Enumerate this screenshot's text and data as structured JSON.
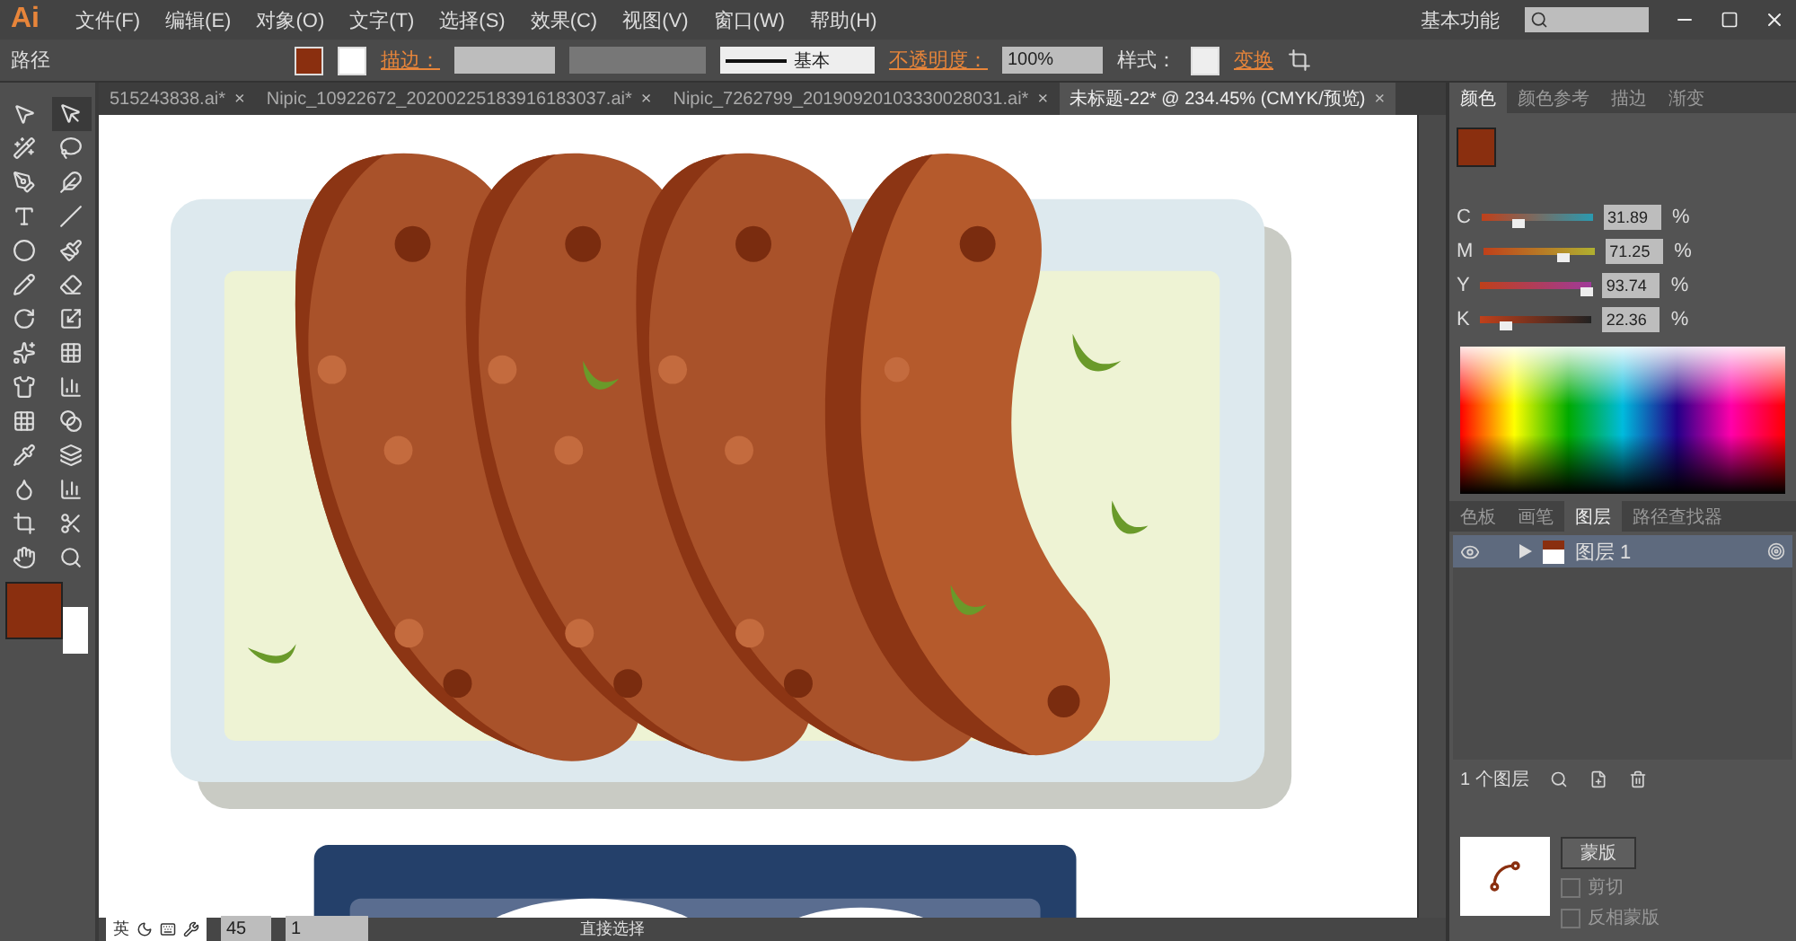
{
  "app_logo": "Ai",
  "menu": [
    "文件(F)",
    "编辑(E)",
    "对象(O)",
    "文字(T)",
    "选择(S)",
    "效果(C)",
    "视图(V)",
    "窗口(W)",
    "帮助(H)"
  ],
  "workspace": "基本功能",
  "control_bar": {
    "object_type": "路径",
    "stroke_label": "描边：",
    "stroke_profile": "基本",
    "opacity_label": "不透明度：",
    "opacity": "100%",
    "style_label": "样式：",
    "transform_label": "变换"
  },
  "doc_tabs": [
    {
      "label": "515243838.ai*",
      "close": "×",
      "selected": false
    },
    {
      "label": "Nipic_10922672_20200225183916183037.ai*",
      "close": "×",
      "selected": false
    },
    {
      "label": "Nipic_7262799_20190920103330028031.ai*",
      "close": "×",
      "selected": false
    },
    {
      "label": "未标题-22* @ 234.45% (CMYK/预览)",
      "close": "×",
      "selected": true
    }
  ],
  "color_panel": {
    "tabs": [
      {
        "label": "颜色",
        "selected": true
      },
      {
        "label": "颜色参考",
        "selected": false
      },
      {
        "label": "描边",
        "selected": false
      },
      {
        "label": "渐变",
        "selected": false
      }
    ],
    "channels": [
      {
        "name": "C",
        "level": 0.32,
        "value": "31.89"
      },
      {
        "name": "M",
        "level": 0.71,
        "value": "71.25"
      },
      {
        "name": "Y",
        "level": 0.94,
        "value": "93.74"
      },
      {
        "name": "K",
        "level": 0.22,
        "value": "22.36"
      }
    ],
    "unit": "%"
  },
  "layers_panel": {
    "tabs": [
      {
        "label": "色板",
        "selected": false
      },
      {
        "label": "画笔",
        "selected": false
      },
      {
        "label": "图层",
        "selected": true
      },
      {
        "label": "路径查找器",
        "selected": false
      }
    ],
    "layers": [
      {
        "name": "图层 1",
        "visible": true,
        "selected": true
      }
    ],
    "count": "1 个图层"
  },
  "transparency_panel": {
    "mask_button": "蒙版",
    "options": [
      {
        "label": "剪切",
        "checked": false
      },
      {
        "label": "反相蒙版",
        "checked": false
      }
    ]
  },
  "status_bar": {
    "zoom": "45",
    "page": "1",
    "tool": "直接选择"
  },
  "ime_bar": {
    "label": "英"
  }
}
